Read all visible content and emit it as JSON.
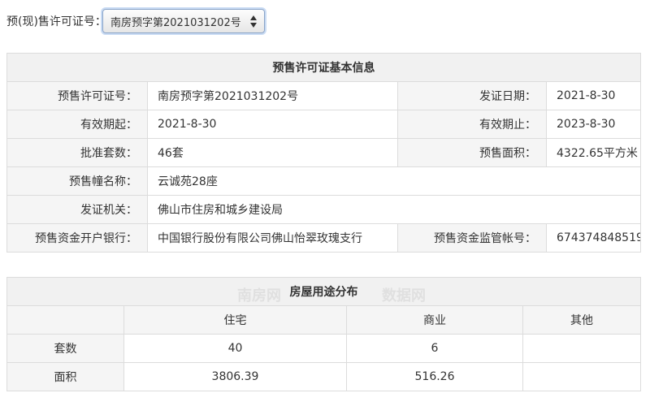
{
  "selector": {
    "label": "预(现)售许可证号：",
    "selected": "南房预字第2021031202号",
    "icon": "updown-arrows-icon"
  },
  "basic_info": {
    "title": "预售许可证基本信息",
    "rows": [
      {
        "label1": "预售许可证号：",
        "value1": "南房预字第2021031202号",
        "label2": "发证日期：",
        "value2": "2021-8-30"
      },
      {
        "label1": "有效期起：",
        "value1": "2021-8-30",
        "label2": "有效期止：",
        "value2": "2023-8-30"
      },
      {
        "label1": "批准套数：",
        "value1": "46套",
        "label2": "预售面积：",
        "value2": "4322.65平方米"
      }
    ],
    "building_name": {
      "label": "预售幢名称：",
      "value": "云诚苑28座"
    },
    "issuer": {
      "label": "发证机关：",
      "value": "佛山市住房和城乡建设局"
    },
    "bank": {
      "label": "预售资金开户银行：",
      "value": "中国银行股份有限公司佛山怡翠玫瑰支行",
      "label2": "预售资金监管帐号：",
      "value2": "674374848519"
    }
  },
  "usage": {
    "title": "房屋用途分布",
    "columns": [
      "",
      "住宅",
      "商业",
      "其他"
    ],
    "rows": [
      {
        "label": "套数",
        "values": [
          "40",
          "6",
          ""
        ]
      },
      {
        "label": "面积",
        "values": [
          "3806.39",
          "516.26",
          ""
        ]
      }
    ]
  },
  "watermark": {
    "text": "南房网",
    "text2": "数据网"
  }
}
